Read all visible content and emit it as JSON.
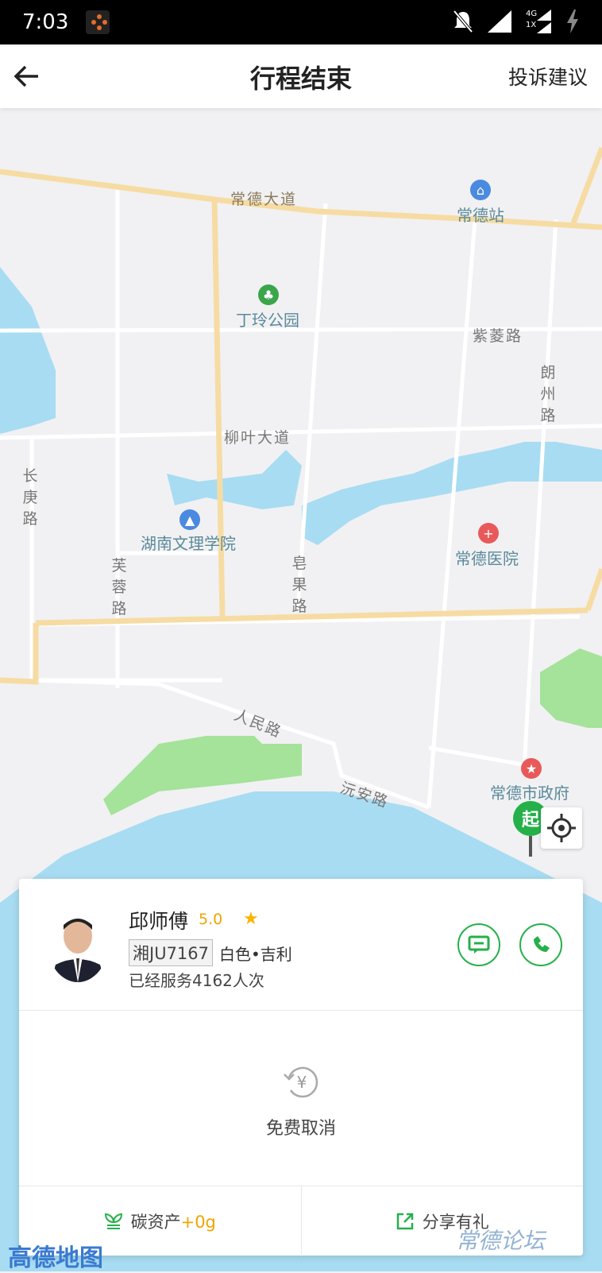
{
  "status_bar": {
    "time": "7:03",
    "network": "4G",
    "network_sub": "1X"
  },
  "nav": {
    "title": "行程结束",
    "complain": "投诉建议"
  },
  "map": {
    "roads": {
      "changde_avenue": "常德大道",
      "ziling_road": "紫菱路",
      "liuye_avenue": "柳叶大道",
      "lang_zhou_road": "朗州路",
      "changgeng_road": "长庚路",
      "furong_road": "芙蓉路",
      "zaoguo_road": "皂果路",
      "renmin_road": "人民路",
      "yuanan_road": "沅安路"
    },
    "pois": {
      "station": "常德站",
      "park": "丁玲公园",
      "college": "湖南文理学院",
      "hospital": "常德医院",
      "government": "常德市政府"
    },
    "start_marker": "起",
    "logo": "高德地图"
  },
  "driver": {
    "name": "邱师傅",
    "rating": "5.0",
    "plate": "湘JU7167",
    "car": "白色•吉利",
    "served": "已经服务4162人次"
  },
  "cancel": {
    "label": "免费取消"
  },
  "bottom": {
    "carbon_label": "碳资产",
    "carbon_value": "+0g",
    "share_label": "分享有礼"
  },
  "watermark": "常德论坛"
}
